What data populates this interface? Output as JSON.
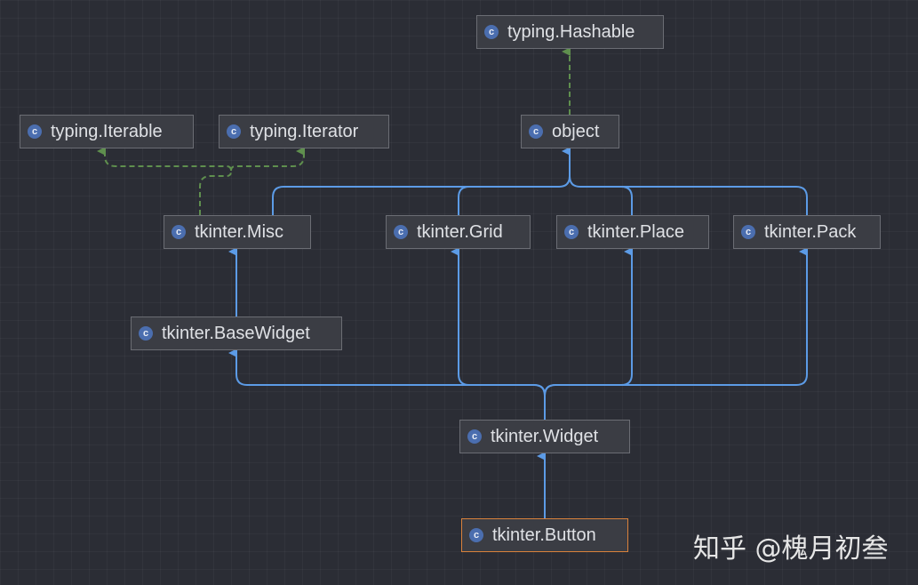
{
  "colors": {
    "inheritance_edge": "#5c9be6",
    "implements_edge": "#5f8f4e",
    "class_icon": "#4b6eaf",
    "selected_border": "#d9823b"
  },
  "nodes": {
    "hashable": {
      "label": "typing.Hashable",
      "icon": "class-icon"
    },
    "iterable": {
      "label": "typing.Iterable",
      "icon": "class-icon"
    },
    "iterator": {
      "label": "typing.Iterator",
      "icon": "class-icon"
    },
    "object": {
      "label": "object",
      "icon": "class-icon"
    },
    "misc": {
      "label": "tkinter.Misc",
      "icon": "class-icon"
    },
    "grid": {
      "label": "tkinter.Grid",
      "icon": "class-icon"
    },
    "place": {
      "label": "tkinter.Place",
      "icon": "class-icon"
    },
    "pack": {
      "label": "tkinter.Pack",
      "icon": "class-icon"
    },
    "basewidget": {
      "label": "tkinter.BaseWidget",
      "icon": "class-icon"
    },
    "widget": {
      "label": "tkinter.Widget",
      "icon": "class-icon"
    },
    "button": {
      "label": "tkinter.Button",
      "icon": "class-icon",
      "selected": true
    }
  },
  "icon_letter": "c",
  "edges": [
    {
      "from": "object",
      "to": "hashable",
      "kind": "implements"
    },
    {
      "from": "misc",
      "to": "iterable",
      "kind": "implements"
    },
    {
      "from": "misc",
      "to": "iterator",
      "kind": "implements"
    },
    {
      "from": "misc",
      "to": "object",
      "kind": "extends"
    },
    {
      "from": "grid",
      "to": "object",
      "kind": "extends"
    },
    {
      "from": "place",
      "to": "object",
      "kind": "extends"
    },
    {
      "from": "pack",
      "to": "object",
      "kind": "extends"
    },
    {
      "from": "basewidget",
      "to": "misc",
      "kind": "extends"
    },
    {
      "from": "widget",
      "to": "basewidget",
      "kind": "extends"
    },
    {
      "from": "widget",
      "to": "grid",
      "kind": "extends"
    },
    {
      "from": "widget",
      "to": "place",
      "kind": "extends"
    },
    {
      "from": "widget",
      "to": "pack",
      "kind": "extends"
    },
    {
      "from": "button",
      "to": "widget",
      "kind": "extends"
    }
  ],
  "watermark": "知乎 @槐月初叁"
}
